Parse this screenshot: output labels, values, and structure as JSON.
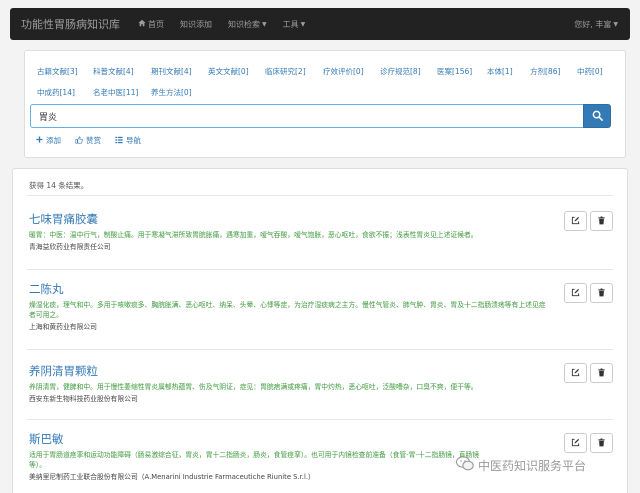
{
  "navbar": {
    "brand": "功能性胃肠病知识库",
    "items": [
      {
        "label": "首页",
        "icon": "home-icon"
      },
      {
        "label": "知识添加"
      },
      {
        "label": "知识检索",
        "dropdown": true
      },
      {
        "label": "工具",
        "dropdown": true
      }
    ],
    "user": "您好, 丰富"
  },
  "search": {
    "categories": [
      "古籍文献[3]",
      "科普文献[4]",
      "期刊文献[4]",
      "英文文献[0]",
      "临床研究[2]",
      "疗效评价[0]",
      "诊疗规范[8]",
      "医案[156]",
      "本体[1]",
      "方剂[86]",
      "中药[0]",
      "中成药[14]",
      "名老中医[11]",
      "养生方法[0]"
    ],
    "query": "胃炎",
    "actions": [
      "添加",
      "赞赏",
      "导航"
    ]
  },
  "results": {
    "count_text": "获得 14 条结果。",
    "items": [
      {
        "title": "七味胃痛胶囊",
        "desc": "暖胃：中医：温中行气，制酸止痛。用于寒凝气滞所致胃脘胀痛，遇寒加重，嗳气吞酸，嗳气饱胀，恶心呕吐，食欲不振；浅表性胃炎见上述证候者。",
        "company": "青海益欣药业有限责任公司"
      },
      {
        "title": "二陈丸",
        "desc": "燥湿化痰，理气和中。多用于咳嗽痰多、胸脘胀满、恶心呕吐、纳呆、头晕、心悸等症，为治疗湿痰病之主方。慢性气管炎、肺气肿、胃炎、胃及十二指肠溃疡等有上述见症者可用之。",
        "company": "上海和黄药业有限公司"
      },
      {
        "title": "养阴清胃颗粒",
        "desc": "养阴清胃，健脾和中。用于慢性萎缩性胃炎属郁热蕴胃、伤及气阴证，症见：胃脘痞满或疼痛，胃中灼热，恶心呕吐，泛酸嘈杂，口臭不爽，便干等。",
        "company": "西安东新生物科技药业股份有限公司"
      },
      {
        "title": "斯巴敏",
        "desc": "适用于胃肠道痉挛和运动功能障碍（肠易激综合征，胃炎，胃十二指肠炎，肠炎，食管痉挛）。也可用于内镜检查前准备（食管-胃-十二指肠镜，直肠镜等）。",
        "company": "美纳里尼制药工业联合股份有限公司（A.Menarini Industrie Farmaceutiche Riunite S.r.l.）"
      }
    ]
  },
  "watermark": "中医药知识服务平台",
  "colors": {
    "link": "#337ab7",
    "desc": "#3c9a3c",
    "navbar": "#222222"
  }
}
